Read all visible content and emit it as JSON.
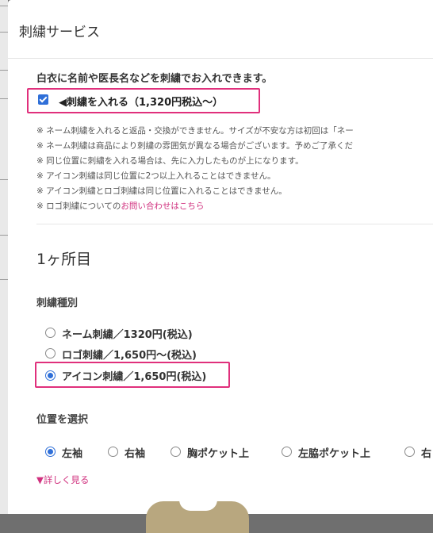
{
  "modal": {
    "title": "刺繍サービス",
    "intro": "白衣に名前や医長名などを刺繍でお入れできます。",
    "embroider_checkbox": {
      "label": "◀刺繍を入れる（1,320円税込〜）",
      "checked": true
    },
    "notes": [
      {
        "text": "※ ネーム刺繍を入れると返品・交換ができません。サイズが不安な方は初回は「ネー"
      },
      {
        "text": "※ ネーム刺繍は商品により刺繍の雰囲気が異なる場合がございます。予めご了承くだ"
      },
      {
        "text": "※ 同じ位置に刺繍を入れる場合は、先に入力したものが上になります。"
      },
      {
        "text": "※ アイコン刺繍は同じ位置に2つ以上入れることはできません。"
      },
      {
        "text": "※ アイコン刺繍とロゴ刺繍は同じ位置に入れることはできません。"
      },
      {
        "text": "※ ロゴ刺繍についての",
        "link": "お問い合わせはこちら"
      }
    ],
    "section_title": "1ヶ所目",
    "type_label": "刺繍種別",
    "types": [
      {
        "label": "ネーム刺繍／1320円(税込)",
        "selected": false
      },
      {
        "label": "ロゴ刺繍／1,650円〜(税込)",
        "selected": false
      },
      {
        "label": "アイコン刺繍／1,650円(税込)",
        "selected": true
      }
    ],
    "position_label": "位置を選択",
    "positions": [
      {
        "label": "左袖",
        "selected": true
      },
      {
        "label": "右袖",
        "selected": false
      },
      {
        "label": "胸ポケット上",
        "selected": false
      },
      {
        "label": "左脇ポケット上",
        "selected": false
      },
      {
        "label": "右",
        "selected": false
      }
    ],
    "more_link": "▼詳しく見る"
  },
  "colors": {
    "accent": "#e0307c",
    "link": "#d0307e",
    "check": "#2f6fd8"
  }
}
